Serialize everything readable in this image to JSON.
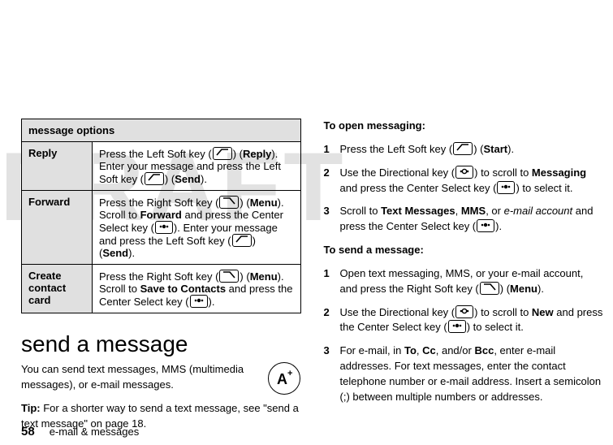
{
  "watermark": "DRAFT",
  "left": {
    "table_header": "message options",
    "rows": [
      {
        "label": "Reply",
        "desc_a": "Press the Left Soft key (",
        "desc_b": ") (",
        "sk1": "Reply",
        "desc_c": "). Enter your message and press the Left Soft key (",
        "desc_d": ") (",
        "sk2": "Send",
        "desc_e": ")."
      },
      {
        "label": "Forward",
        "desc_a": "Press the Right Soft key (",
        "desc_b": ") (",
        "sk1": "Menu",
        "desc_c": "). Scroll to  ",
        "tgt1": "Forward",
        "desc_d": " and press the Center Select key (",
        "desc_e": "). Enter your message and press the Left Soft key (",
        "desc_f": ") (",
        "sk2": "Send",
        "desc_g": ")."
      },
      {
        "label": "Create contact card",
        "desc_a": "Press the Right Soft key (",
        "desc_b": ") (",
        "sk1": "Menu",
        "desc_c": "). Scroll to  ",
        "tgt1": "Save to Contacts",
        "desc_d": " and press the Center Select key (",
        "desc_e": ")."
      }
    ],
    "heading": "send a message",
    "intro": "You can send text messages, MMS (multimedia messages), or e-mail messages.",
    "tip_label": "Tip:",
    "tip_text": " For a shorter way to send a text message, see \"send a text message\" on page 18.",
    "icon_circle_name": "letter-a-plus-icon"
  },
  "right": {
    "h_open": "To open messaging:",
    "open_steps": [
      {
        "n": "1",
        "a": "Press the Left Soft key (",
        "b": ") (",
        "sk": "Start",
        "c": ")."
      },
      {
        "n": "2",
        "a": "Use the Directional key (",
        "b": ") to scroll to ",
        "tgt": "Messaging",
        "c": " and press the Center Select key (",
        "d": ") to select it."
      },
      {
        "n": "3",
        "a": "Scroll to ",
        "tgt1": "Text Messages",
        "sep1": ", ",
        "tgt2": "MMS",
        "sep2": ", or ",
        "it": "e-mail account",
        "b": " and press the Center Select key (",
        "c": ")."
      }
    ],
    "h_send": "To send a message:",
    "send_steps": [
      {
        "n": "1",
        "a": "Open text messaging, MMS, or your e-mail account, and press the Right Soft key (",
        "b": ") (",
        "sk": "Menu",
        "c": ")."
      },
      {
        "n": "2",
        "a": "Use the Directional key (",
        "b": ") to scroll to ",
        "tgt": "New",
        "c": " and press the Center Select key (",
        "d": ") to select it."
      },
      {
        "n": "3",
        "a": "For e-mail, in ",
        "f1": "To",
        "s1": ", ",
        "f2": "Cc",
        "s2": ", and/or ",
        "f3": "Bcc",
        "b": ", enter e-mail addresses. For text messages, enter the contact telephone number or e-mail address. Insert a semicolon (;) between multiple numbers or addresses."
      }
    ]
  },
  "footer": {
    "page": "58",
    "section": "e-mail & messages"
  }
}
